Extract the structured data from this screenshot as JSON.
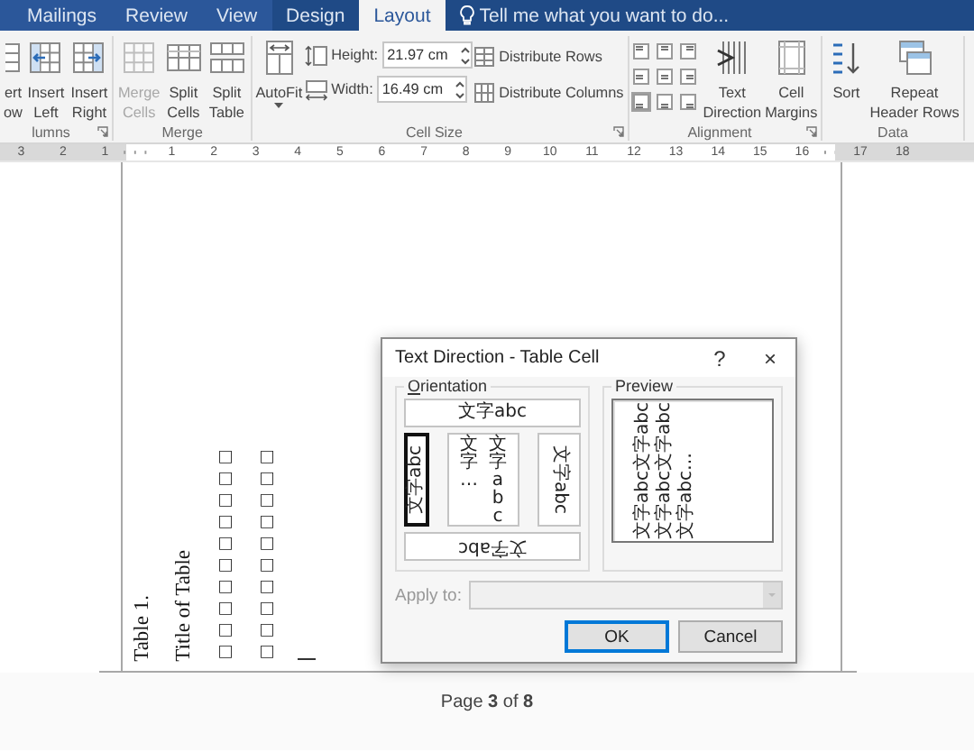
{
  "ribbon_tabs": [
    {
      "label": "Mailings",
      "selected": false,
      "contextual": false
    },
    {
      "label": "Review",
      "selected": false,
      "contextual": false
    },
    {
      "label": "View",
      "selected": false,
      "contextual": false
    },
    {
      "label": "Design",
      "selected": false,
      "contextual": true
    },
    {
      "label": "Layout",
      "selected": true,
      "contextual": true
    }
  ],
  "tell_me": {
    "placeholder": "Tell me what you want to do..."
  },
  "ribbon_groups": [
    {
      "label": "lumns",
      "launcher": true,
      "items": [
        {
          "kind": "large",
          "lines": [
            "ert",
            "ow"
          ],
          "disabled": false
        },
        {
          "kind": "large",
          "lines": [
            "Insert",
            "Left"
          ],
          "disabled": false
        },
        {
          "kind": "large",
          "lines": [
            "Insert",
            "Right"
          ],
          "disabled": false
        }
      ]
    },
    {
      "label": "Merge",
      "launcher": false,
      "items": [
        {
          "kind": "large",
          "lines": [
            "Merge",
            "Cells"
          ],
          "disabled": true
        },
        {
          "kind": "large",
          "lines": [
            "Split",
            "Cells"
          ],
          "disabled": false
        },
        {
          "kind": "large",
          "lines": [
            "Split",
            "Table"
          ],
          "disabled": false
        }
      ]
    },
    {
      "label": "Cell Size",
      "launcher": true,
      "items": [
        {
          "kind": "large",
          "lines": [
            "AutoFit"
          ],
          "disabled": false,
          "dropdown": true
        },
        {
          "kind": "fields",
          "fields": [
            {
              "label": "Height:",
              "value": "21.97 cm"
            },
            {
              "label": "Width:",
              "value": "16.49 cm"
            }
          ]
        },
        {
          "kind": "small-stack",
          "buttons": [
            "Distribute Rows",
            "Distribute Columns"
          ]
        }
      ]
    },
    {
      "label": "Alignment",
      "launcher": true,
      "items": [
        {
          "kind": "align-grid",
          "cells": [
            {
              "selected": false
            },
            {
              "selected": false
            },
            {
              "selected": false
            },
            {
              "selected": false
            },
            {
              "selected": false
            },
            {
              "selected": false
            },
            {
              "selected": true
            },
            {
              "selected": false
            },
            {
              "selected": false
            }
          ]
        },
        {
          "kind": "large",
          "lines": [
            "Text",
            "Direction"
          ],
          "disabled": false
        },
        {
          "kind": "large",
          "lines": [
            "Cell",
            "Margins"
          ],
          "disabled": false
        }
      ]
    },
    {
      "label": "Data",
      "launcher": false,
      "items": [
        {
          "kind": "large",
          "lines": [
            "Sort"
          ],
          "disabled": false
        },
        {
          "kind": "large",
          "lines": [
            "Repeat",
            "Header Rows"
          ],
          "disabled": false
        }
      ]
    }
  ],
  "ruler": {
    "left_labels": [
      "3",
      "2",
      "1"
    ],
    "labels": [
      "1",
      "2",
      "3",
      "4",
      "5",
      "6",
      "7",
      "8",
      "9",
      "10",
      "11",
      "12",
      "13",
      "14",
      "15",
      "16"
    ],
    "right_labels": [
      "17",
      "18"
    ]
  },
  "table_cell": {
    "lines": [
      "Table 1.",
      "Title of Table",
      "□□□□□□□□□□",
      "□□□□□□□□□□"
    ]
  },
  "status": "Page **3** of **8**",
  "dialog": {
    "title": "Text Direction - Table Cell",
    "help": "?",
    "close": "×",
    "orientation_label": "Orientation",
    "orientation_options": [
      {
        "kind": "horizontal",
        "text": "文字abc",
        "selected": false
      },
      {
        "kind": "rotate-up",
        "text": "文字abc",
        "selected": true
      },
      {
        "kind": "stacked",
        "lines": [
          "文字…",
          "文字abc"
        ],
        "selected": false
      },
      {
        "kind": "rotate-down",
        "text": "文字abc",
        "selected": false
      },
      {
        "kind": "upside-down",
        "text": "文字abc",
        "selected": false
      }
    ],
    "preview_label": "Preview",
    "preview_text": "文字abc文字abc文字abc文字abc文字abc…",
    "apply_to": {
      "label": "Apply to:",
      "disabled": true
    },
    "buttons": [
      {
        "label": "OK",
        "default": true
      },
      {
        "label": "Cancel",
        "default": false
      }
    ]
  }
}
